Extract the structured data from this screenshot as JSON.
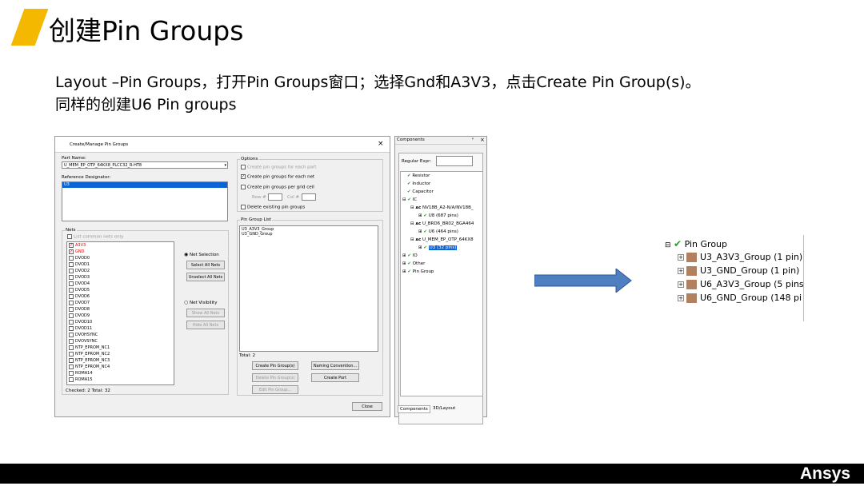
{
  "slide": {
    "title": "创建Pin Groups",
    "line1": "Layout –Pin Groups，打开Pin Groups窗口；选择Gnd和A3V3，点击Create Pin Group(s)。",
    "line2": "同样的创建U6  Pin groups",
    "logo": "Ansys",
    "accent_color": "#f5b800"
  },
  "dialog": {
    "title": "Create/Manage Pin Groups",
    "close_icon": "×",
    "part_name_label": "Part Name:",
    "part_name_value": "U_MEM_EP_OTP_64KX8_PLCC32_R-HT8",
    "ref_des_label": "Reference Designator:",
    "ref_des_value": "U3",
    "nets_label": "Nets",
    "list_common_nets": "List common nets only",
    "nets": [
      "A3V3",
      "GND",
      "DVOD0",
      "DVOD1",
      "DVOD2",
      "DVOD3",
      "DVOD4",
      "DVOD5",
      "DVOD6",
      "DVOD7",
      "DVOD8",
      "DVOD9",
      "DVOD10",
      "DVOD11",
      "DVOHSYNC",
      "DVOVSYNC",
      "NTP_EPROM_NC1",
      "NTP_EPROM_NC2",
      "NTP_EPROM_NC3",
      "NTP_EPROM_NC4",
      "ROMA14",
      "ROMA15"
    ],
    "net_selection": "Net Selection",
    "select_all": "Select All Nets",
    "unselect_all": "Unselect All Nets",
    "net_visibility": "Net Visibility",
    "show_all": "Show All Nets",
    "hide_all": "Hide All Nets",
    "checked_total": "Checked: 2 Total: 32",
    "options_label": "Options",
    "opt1": "Create pin groups for each part",
    "opt2": "Create pin groups for each net",
    "opt3": "Create pin groups per grid cell",
    "row_label": "Row #",
    "col_label": "Col #",
    "opt4": "Delete existing pin groups",
    "pin_group_list_label": "Pin Group List",
    "pin_groups": [
      "U3_A3V3_Group",
      "U3_GND_Group"
    ],
    "total": "Total: 2",
    "create_btn": "Create Pin Group(s)",
    "naming_btn": "Naming Convention...",
    "delete_btn": "Delete Pin Group(s)",
    "create_port_btn": "Create Port",
    "edit_btn": "Edit Pin Group...",
    "close_btn": "Close"
  },
  "components": {
    "title": "Components",
    "pin": "ᵖ",
    "close": "×",
    "regular_expr": "Regular Expr:",
    "items": [
      "Resistor",
      "Inductor",
      "Capacitor",
      "IC",
      "NV18B_A2-N/A/NV18B_",
      "U8 (687 pins)",
      "U_BRD6_BR02_BGA464",
      "U6 (464 pins)",
      "U_MEM_EP_OTP_64KX8",
      "U3 (32 pins)",
      "IO",
      "Other",
      "Pin Group"
    ],
    "tab1": "Components",
    "tab2": "3D/Layout"
  },
  "pin_group_tree": {
    "root": "Pin Group",
    "items": [
      "U3_A3V3_Group (1 pin)",
      "U3_GND_Group (1 pin)",
      "U6_A3V3_Group (5 pins",
      "U6_GND_Group (148 pi"
    ]
  }
}
